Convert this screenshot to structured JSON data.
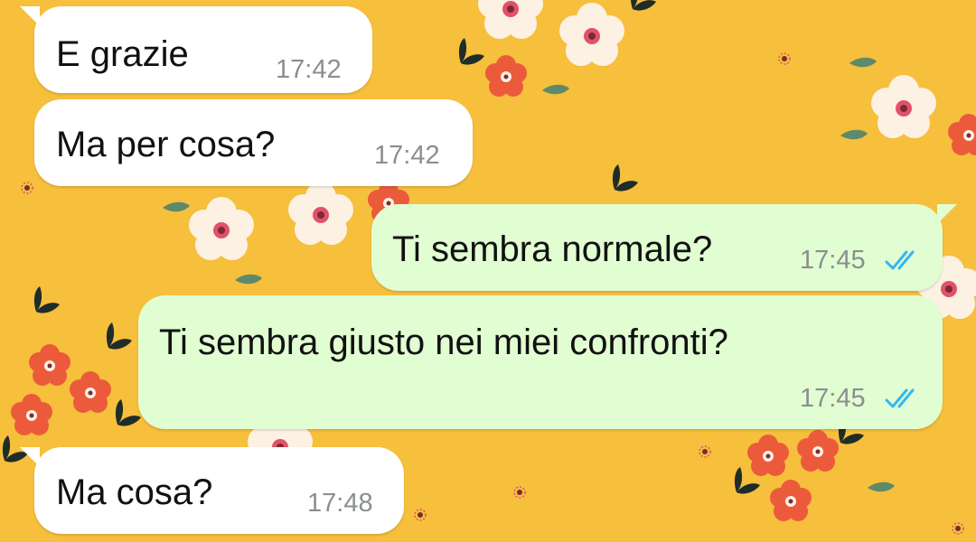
{
  "colors": {
    "wallpaper": "#f6bf3c",
    "incoming_bubble": "#ffffff",
    "outgoing_bubble": "#e1fdd2",
    "read_ticks": "#34b7f1",
    "timestamp": "#8b8e8f"
  },
  "wallpaper": {
    "pattern": "floral",
    "icon": "flower-pattern"
  },
  "messages": [
    {
      "direction": "incoming",
      "text": "E grazie",
      "time": "17:42"
    },
    {
      "direction": "incoming",
      "text": "Ma per cosa?",
      "time": "17:42"
    },
    {
      "direction": "outgoing",
      "text": "Ti sembra normale?",
      "time": "17:45",
      "status_icon": "double-check-read-icon"
    },
    {
      "direction": "outgoing",
      "text": "Ti sembra giusto nei miei confronti?",
      "time": "17:45",
      "status_icon": "double-check-read-icon"
    },
    {
      "direction": "incoming",
      "text": "Ma cosa?",
      "time": "17:48"
    }
  ]
}
